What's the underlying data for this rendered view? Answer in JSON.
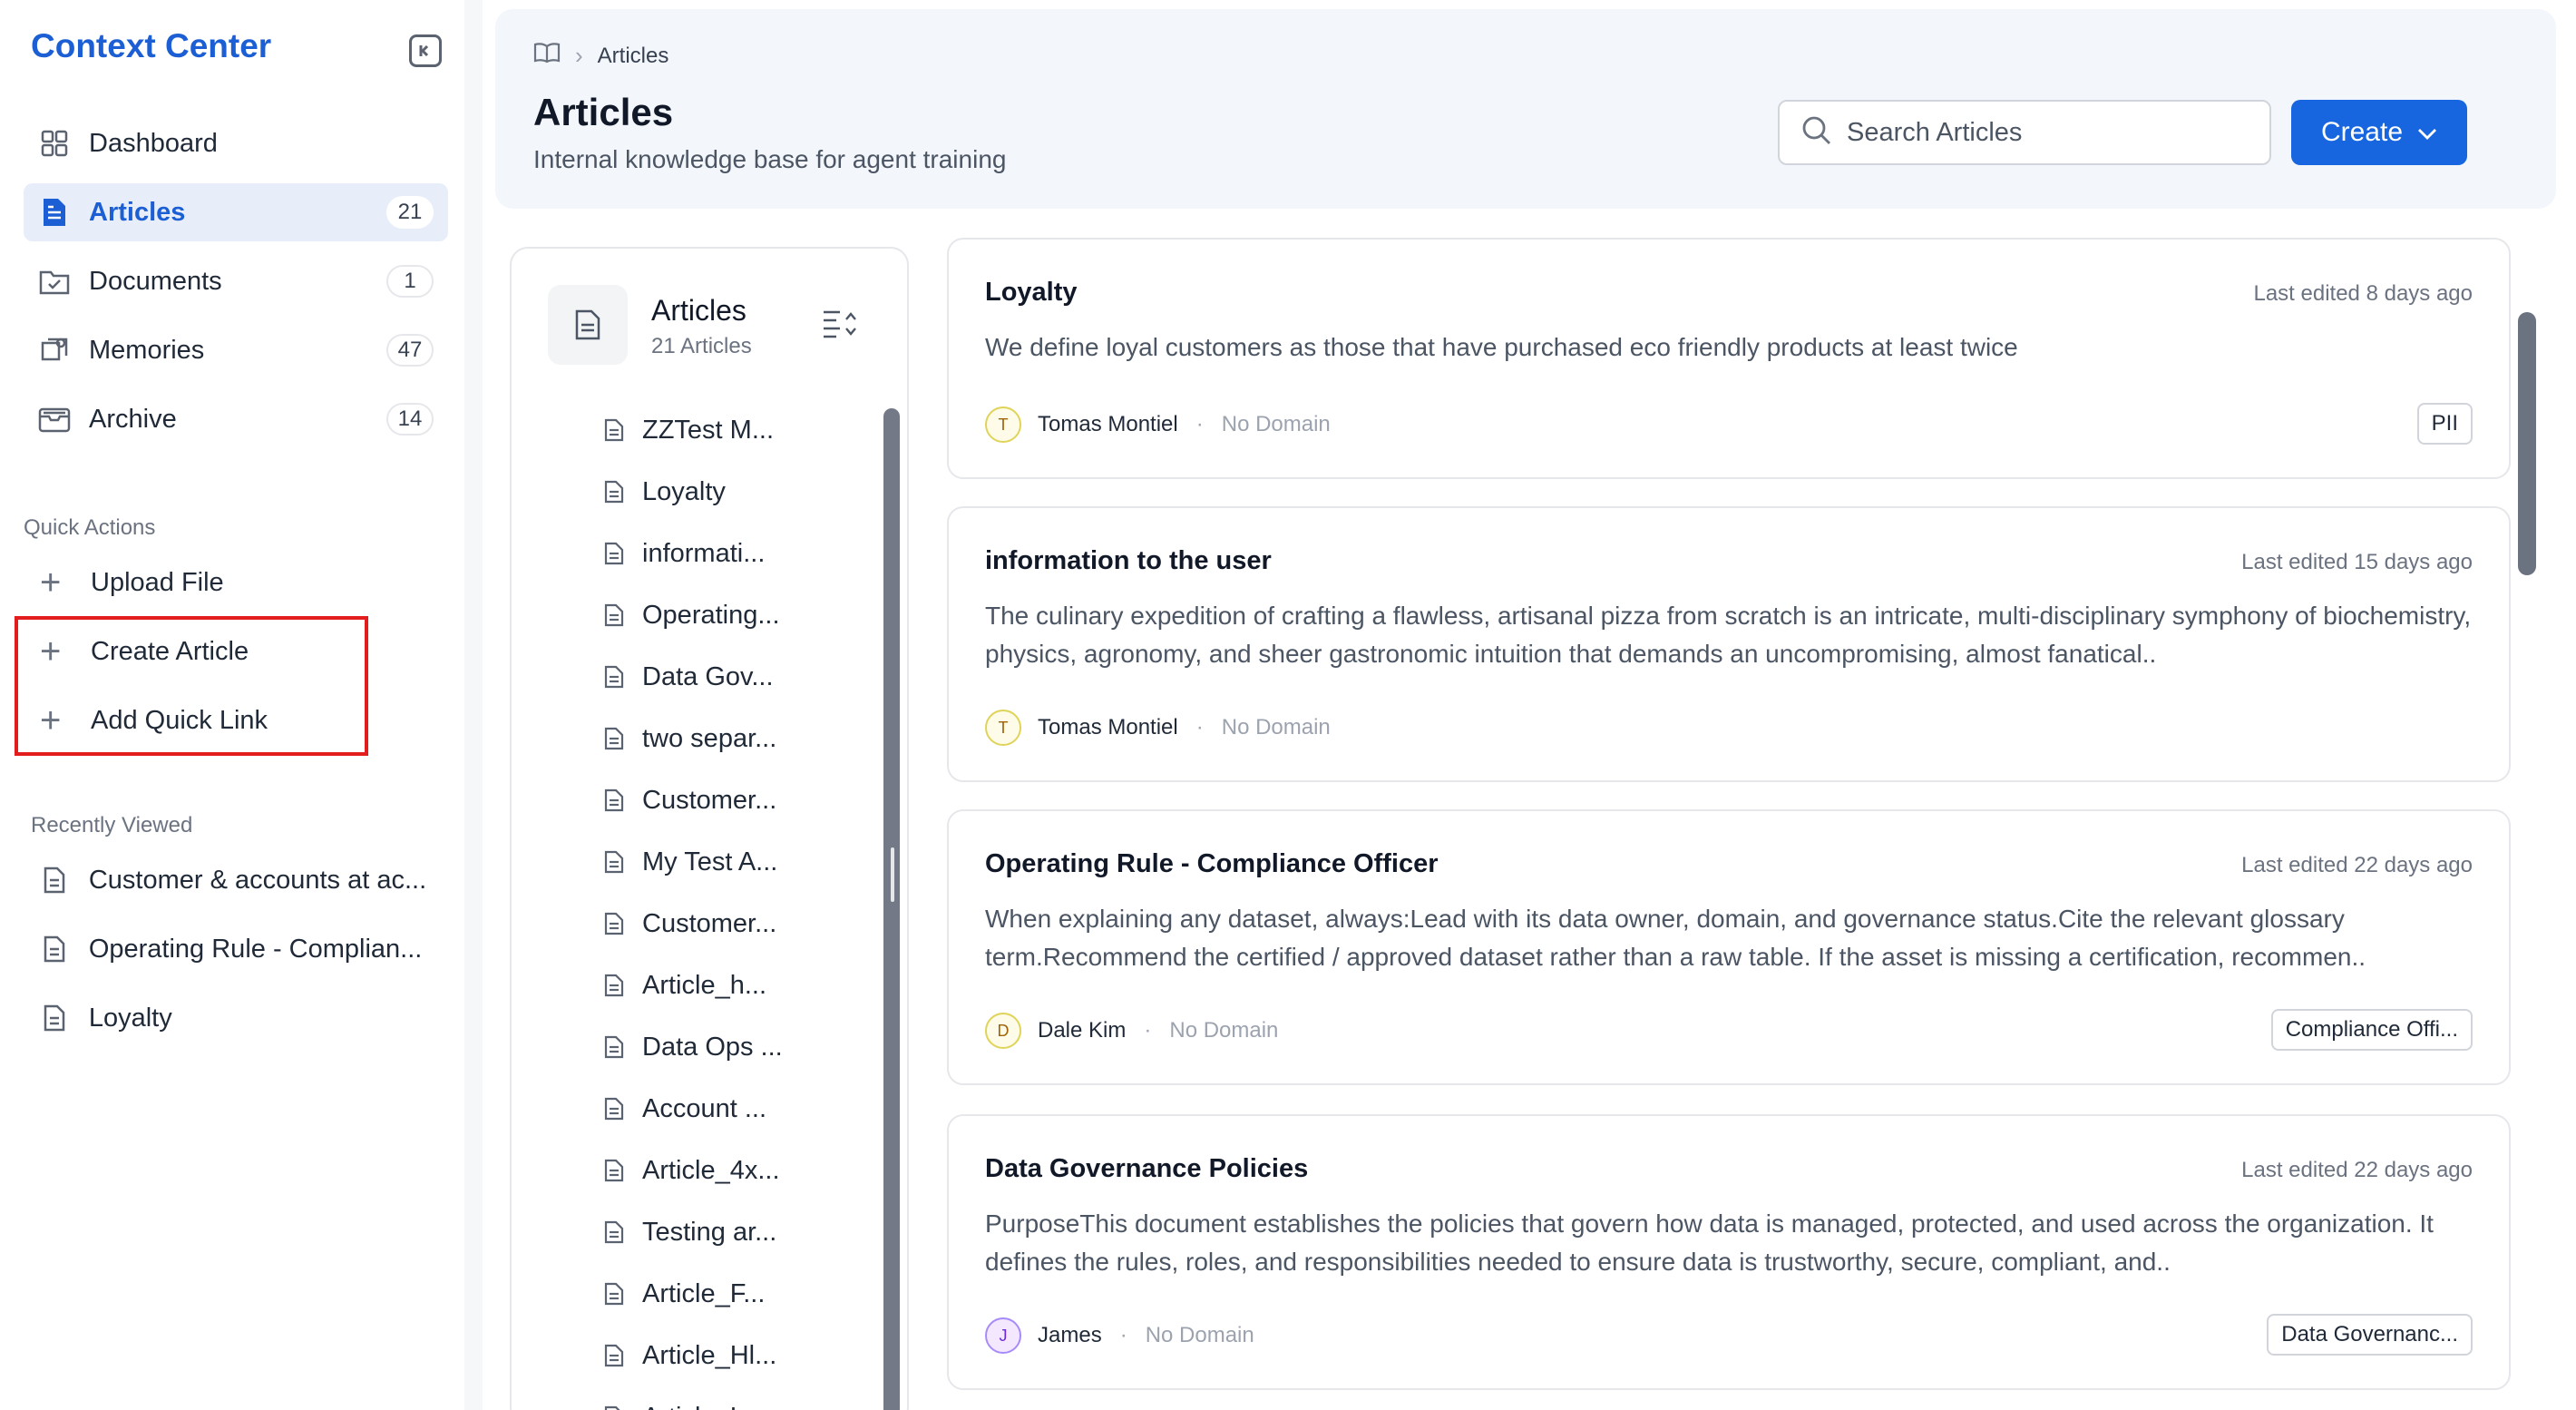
{
  "sidebar": {
    "brand": "Context Center",
    "nav": [
      {
        "label": "Dashboard",
        "icon": "grid-icon"
      },
      {
        "label": "Articles",
        "icon": "article-icon",
        "count": "21",
        "active": true
      },
      {
        "label": "Documents",
        "icon": "folder-icon",
        "count": "1"
      },
      {
        "label": "Memories",
        "icon": "memory-icon",
        "count": "47"
      },
      {
        "label": "Archive",
        "icon": "archive-icon",
        "count": "14"
      }
    ],
    "quick_actions_title": "Quick Actions",
    "quick_actions": [
      "Upload File",
      "Create Article",
      "Add Quick Link"
    ],
    "recently_viewed_title": "Recently Viewed",
    "recently_viewed": [
      "Customer & accounts at ac...",
      "Operating Rule - Complian...",
      "Loyalty"
    ]
  },
  "header": {
    "breadcrumb": "Articles",
    "title": "Articles",
    "subtitle": "Internal knowledge base for agent training",
    "search_placeholder": "Search Articles",
    "create_label": "Create"
  },
  "list_panel": {
    "title": "Articles",
    "count": "21 Articles",
    "items": [
      "ZZTest M...",
      "Loyalty",
      "informati...",
      "Operating...",
      "Data Gov...",
      "two separ...",
      "Customer...",
      "My Test A...",
      "Customer...",
      "Article_h...",
      "Data Ops ...",
      "Account ...",
      "Article_4x...",
      "Testing ar...",
      "Article_F...",
      "Article_Hl...",
      "Article_L..."
    ]
  },
  "articles": [
    {
      "title": "Loyalty",
      "edited": "Last edited 8 days ago",
      "body": "We define loyal customers as those that have purchased eco friendly products at least twice",
      "author": "Tomas Montiel",
      "initial": "T",
      "domain": "No Domain",
      "tag": "PII"
    },
    {
      "title": "information to the user",
      "edited": "Last edited 15 days ago",
      "body": "The culinary expedition of crafting a flawless, artisanal pizza from scratch is an intricate, multi-disciplinary symphony of biochemistry, physics, agronomy, and sheer gastronomic intuition that demands an uncompromising, almost fanatical..",
      "author": "Tomas Montiel",
      "initial": "T",
      "domain": "No Domain",
      "tag": ""
    },
    {
      "title": "Operating Rule - Compliance Officer",
      "edited": "Last edited 22 days ago",
      "body": "When explaining any dataset, always:Lead with its data owner, domain, and governance status.Cite the relevant glossary term.Recommend the certified / approved dataset rather than a raw table. If the asset is missing a certification, recommen..",
      "author": "Dale Kim",
      "initial": "D",
      "domain": "No Domain",
      "tag": "Compliance Offi..."
    },
    {
      "title": "Data Governance Policies",
      "edited": "Last edited 22 days ago",
      "body": "PurposeThis document establishes the policies that govern how data is managed, protected, and used across the organization. It defines the rules, roles, and responsibilities needed to ensure data is trustworthy, secure, compliant, and..",
      "author": "James",
      "initial": "J",
      "domain": "No Domain",
      "tag": "Data Governanc..."
    }
  ]
}
